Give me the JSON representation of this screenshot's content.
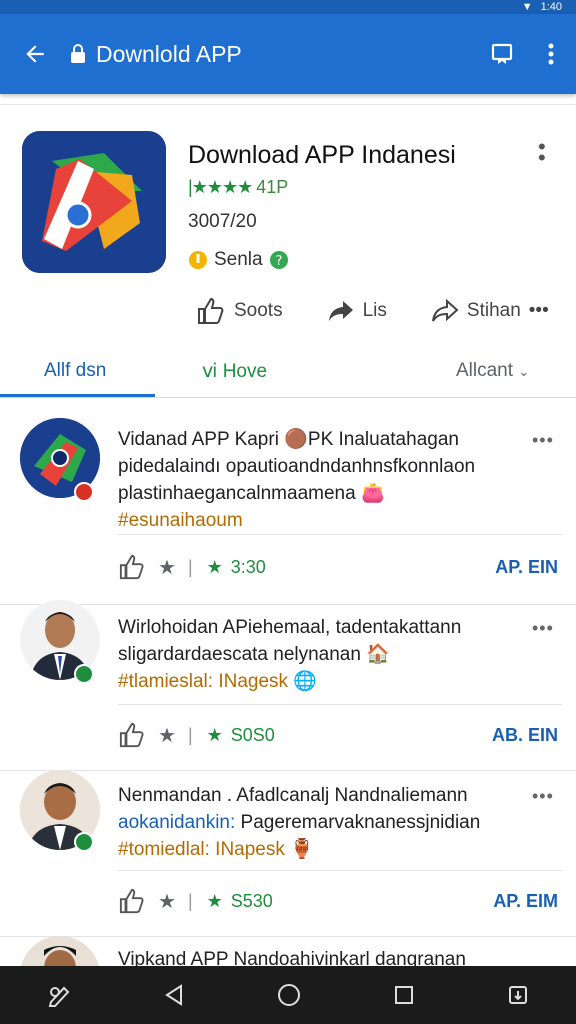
{
  "status": {
    "time": "1:40"
  },
  "appbar": {
    "title": "Downlold APP"
  },
  "app": {
    "title": "Download APP Indanesi",
    "rating": "41P",
    "date": "3007/20",
    "seller": "Senla",
    "actions": {
      "like": "Soots",
      "share": "Lis",
      "more": "Stihan"
    }
  },
  "tabs": {
    "t1": "Allf dsn",
    "t2": "Hove",
    "t3": "Allcant"
  },
  "posts": [
    {
      "l1": "Vidanad APP Kapri",
      "l1b": "PK Inaluatahagan",
      "l2": "pidedalaindı opautioandndanhnsfkonnlaon",
      "l3": "plastinhaegancalnmaamena",
      "l4": "#esunaihaoum",
      "count": "3:30",
      "link": "AP. EIN"
    },
    {
      "l1": "Wirlohoidan APiehemaal, tadentakattann",
      "l2": "sligardardaescata nelynanan",
      "l3": "#tlamieslal: INagesk",
      "count": "S0S0",
      "link": "AB. EIN"
    },
    {
      "l1": "Nenmandan . Afadlcanalj  Nandnaliemann",
      "l2a": "aokanidankin:",
      "l2b": " Pageremarvaknanessjnidian",
      "l3": "#tomiedlal: INapesk",
      "count": "S530",
      "link": "AP. EIM"
    },
    {
      "l1": "Vipkand APP Nandoahivinkarl dangranan"
    }
  ],
  "colors": {
    "appbar": "#1e6fd0",
    "green": "#1e8e3e",
    "tag": "#b36b00"
  }
}
